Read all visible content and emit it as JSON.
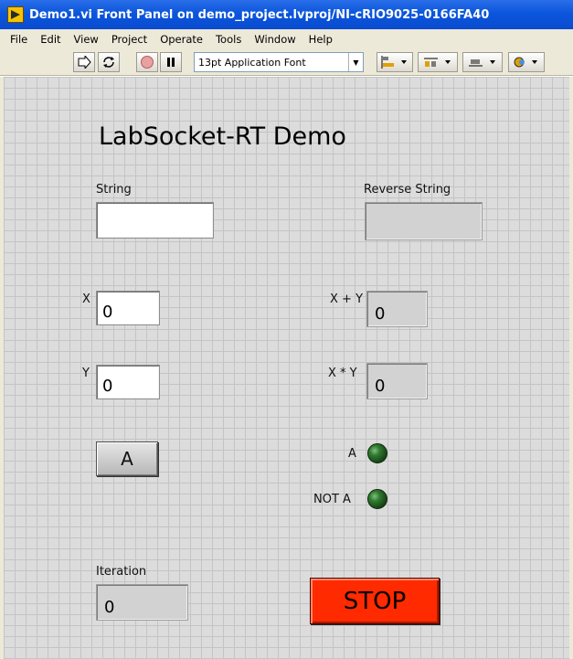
{
  "window": {
    "title": "Demo1.vi Front Panel on demo_project.lvproj/NI-cRIO9025-0166FA40"
  },
  "menu": [
    "File",
    "Edit",
    "View",
    "Project",
    "Operate",
    "Tools",
    "Window",
    "Help"
  ],
  "toolbar": {
    "font_selector": "13pt Application Font",
    "icons": [
      "run-arrow-icon",
      "run-continuously-icon",
      "abort-icon",
      "pause-icon",
      "align-objects-icon",
      "distribute-objects-icon",
      "resize-objects-icon",
      "reorder-icon"
    ]
  },
  "panel": {
    "heading": "LabSocket-RT Demo",
    "string_label": "String",
    "string_value": "",
    "reverse_string_label": "Reverse String",
    "reverse_string_value": "",
    "x_label": "X",
    "x_value": "0",
    "y_label": "Y",
    "y_value": "0",
    "sum_label": "X + Y",
    "sum_value": "0",
    "product_label": "X * Y",
    "product_value": "0",
    "button_a_label": "A",
    "led_a_label": "A",
    "led_not_a_label": "NOT A",
    "iteration_label": "Iteration",
    "iteration_value": "0",
    "stop_label": "STOP"
  },
  "colors": {
    "titlebar": "#0b56dc",
    "stop_button": "#ff2a00",
    "led_off": "#2f7a2f",
    "panel_bg": "#dcdcdc"
  }
}
